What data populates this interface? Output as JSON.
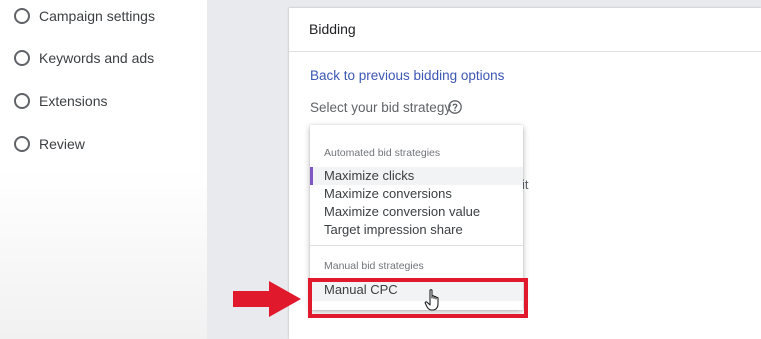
{
  "sidebar": {
    "steps": [
      {
        "label": "Campaign settings"
      },
      {
        "label": "Keywords and ads"
      },
      {
        "label": "Extensions"
      },
      {
        "label": "Review"
      }
    ]
  },
  "card": {
    "title": "Bidding",
    "back_link": "Back to previous bidding options",
    "select_label": "Select your bid strategy",
    "partially_hidden_text": "it"
  },
  "dropdown": {
    "groups": [
      {
        "header": "Automated bid strategies",
        "options": [
          {
            "label": "Maximize clicks",
            "selected": true
          },
          {
            "label": "Maximize conversions"
          },
          {
            "label": "Maximize conversion value"
          },
          {
            "label": "Target impression share"
          }
        ]
      },
      {
        "header": "Manual bid strategies",
        "options": [
          {
            "label": "Manual CPC",
            "hovered": true
          }
        ]
      }
    ]
  },
  "colors": {
    "accent_link": "#3c56b4",
    "highlight_red": "#e0192c",
    "selected_indicator": "#7e57c2"
  },
  "icons": {
    "help": "help-circle-icon",
    "cursor": "hand-pointer-icon",
    "arrow": "red-arrow-right-icon"
  }
}
